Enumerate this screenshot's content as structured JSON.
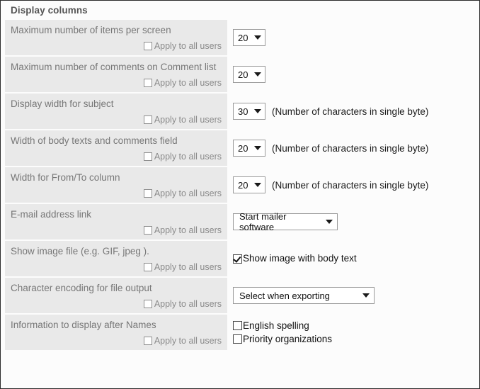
{
  "panel": {
    "title": "Display columns"
  },
  "common": {
    "apply_to_all_users": "Apply to all users",
    "chars_hint": "(Number of characters in single byte)"
  },
  "rows": [
    {
      "label": "Maximum number of items per screen",
      "control": "select-small",
      "value": "20",
      "hint": "",
      "apply_label": "Apply to all users",
      "apply_checked": false
    },
    {
      "label": "Maximum number of comments on Comment list",
      "control": "select-small",
      "value": "20",
      "hint": "",
      "apply_label": "Apply to all users",
      "apply_checked": false
    },
    {
      "label": "Display width for subject",
      "control": "select-small",
      "value": "30",
      "hint": "(Number of characters in single byte)",
      "apply_label": "Apply to all users",
      "apply_checked": false
    },
    {
      "label": "Width of body texts and comments field",
      "control": "select-small",
      "value": "20",
      "hint": "(Number of characters in single byte)",
      "apply_label": "Apply to all users",
      "apply_checked": false
    },
    {
      "label": "Width for From/To column",
      "control": "select-small",
      "value": "20",
      "hint": "(Number of characters in single byte)",
      "apply_label": "Apply to all users",
      "apply_checked": false
    },
    {
      "label": "E-mail address link",
      "control": "select-medium",
      "value": "Start mailer software",
      "hint": "",
      "apply_label": "Apply to all users",
      "apply_checked": false
    },
    {
      "label": "Show image file (e.g. GIF, jpeg ).",
      "control": "checkbox-single",
      "value": "",
      "checkbox_label": "Show image with body text",
      "checkbox_checked": true,
      "hint": "",
      "apply_label": "Apply to all users",
      "apply_checked": false
    },
    {
      "label": "Character encoding for file output",
      "control": "select-large",
      "value": "Select when exporting",
      "hint": "",
      "apply_label": "Apply to all users",
      "apply_checked": false
    },
    {
      "label": "Information to display after Names",
      "control": "checkbox-group",
      "value": "",
      "checkboxes": [
        {
          "label": "English spelling",
          "checked": false
        },
        {
          "label": "Priority organizations",
          "checked": false
        }
      ],
      "hint": "",
      "apply_label": "Apply to all users",
      "apply_checked": false
    }
  ],
  "colors": {
    "row_background": "#e9e9e9",
    "page_background": "#fcfcfc",
    "label_text": "#777777",
    "title_text": "#555555",
    "border": "#2b2b2b"
  }
}
